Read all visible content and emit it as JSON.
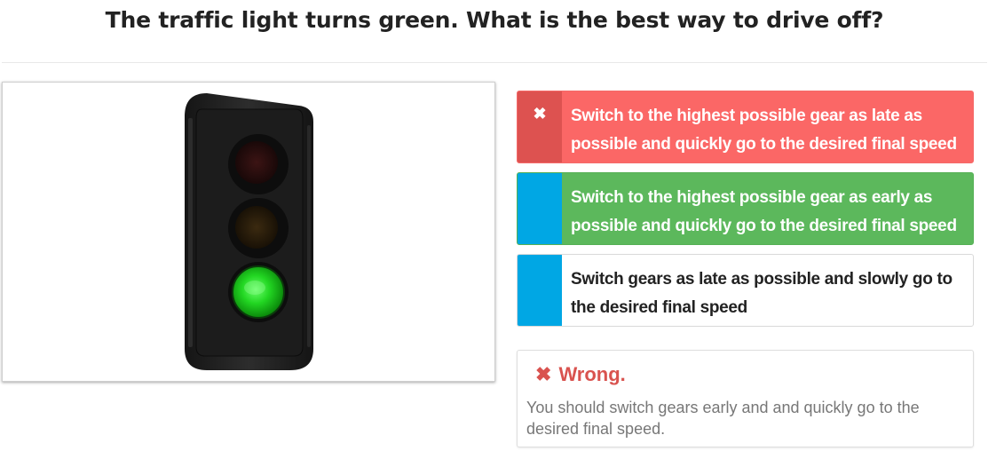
{
  "question": {
    "title": "The traffic light turns green. What is the best way to drive off?"
  },
  "image": {
    "subject": "traffic-light",
    "active_light": "green"
  },
  "answers": [
    {
      "text": "Switch to the highest possible gear as late as possible and quickly go to the desired final speed",
      "state": "selected-wrong",
      "marker_icon": "cross-icon",
      "color": "#fb6766"
    },
    {
      "text": "Switch to the highest possible gear as early as possible and quickly go to the desired final speed",
      "state": "correct",
      "color": "#5cb85c"
    },
    {
      "text": "Switch gears as late as possible and slowly go to the desired final speed",
      "state": "neutral",
      "color": "#ffffff"
    }
  ],
  "feedback": {
    "status_icon": "cross-icon",
    "status": "Wrong.",
    "explanation": "You should switch gears early and and quickly go to the desired final speed.",
    "color": "#d9534f"
  },
  "colors": {
    "marker_blue": "#00a7e4",
    "wrong_red": "#fb6766",
    "correct_green": "#5cb85c"
  }
}
